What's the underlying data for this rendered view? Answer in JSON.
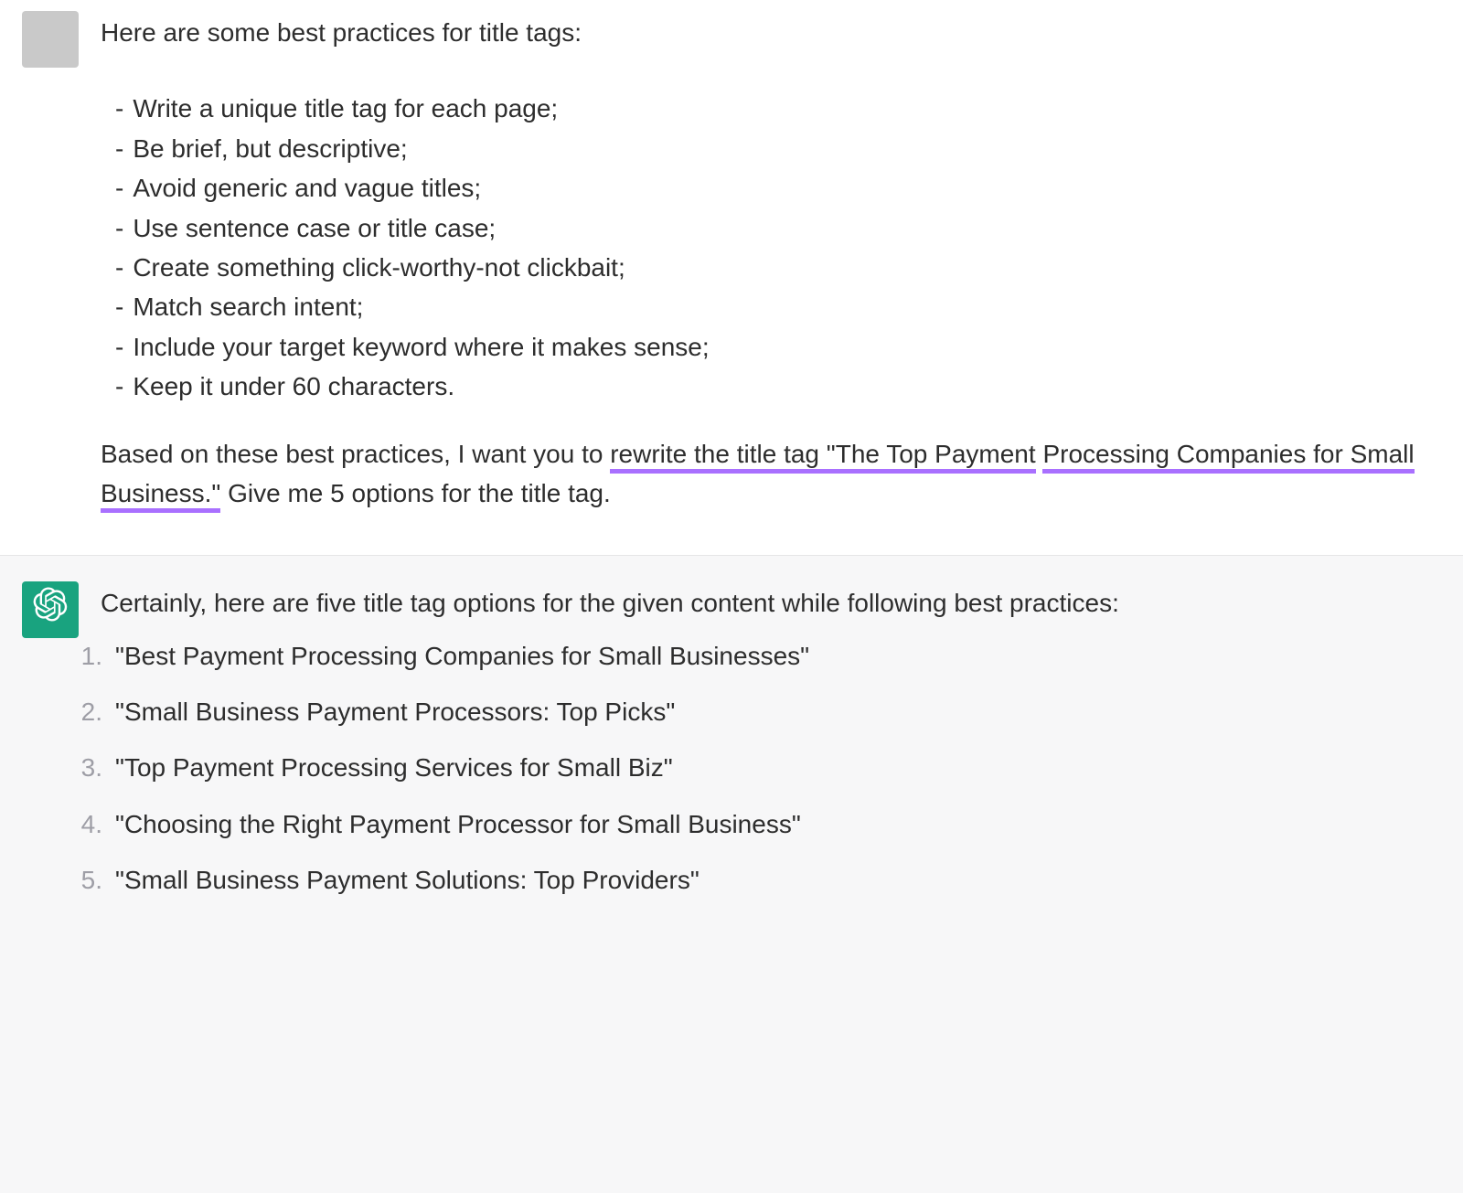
{
  "user_message": {
    "intro": "Here are some best practices for title tags:",
    "bullets": [
      "Write a unique title tag for each page;",
      "Be brief, but descriptive;",
      "Avoid generic and vague titles;",
      "Use sentence case or title case;",
      "Create something click-worthy-not clickbait;",
      "Match search intent;",
      "Include your target keyword where it makes sense;",
      "Keep it under 60 characters."
    ],
    "closing": {
      "pre": "Based on these best practices, I want you to ",
      "hl1": "rewrite the title tag \"The Top Payment",
      "hl2": "Processing Companies for Small Business.\"",
      "post": " Give me 5 options for the title tag."
    }
  },
  "assistant_message": {
    "intro": "Certainly, here are five title tag options for the given content while following best practices:",
    "options": [
      "\"Best Payment Processing Companies for Small Businesses\"",
      "\"Small Business Payment Processors: Top Picks\"",
      "\"Top Payment Processing Services for Small Biz\"",
      "\"Choosing the Right Payment Processor for Small Business\"",
      "\"Small Business Payment Solutions: Top Providers\""
    ]
  },
  "colors": {
    "highlight": "#a970ff",
    "assistant_avatar": "#19a37f"
  }
}
